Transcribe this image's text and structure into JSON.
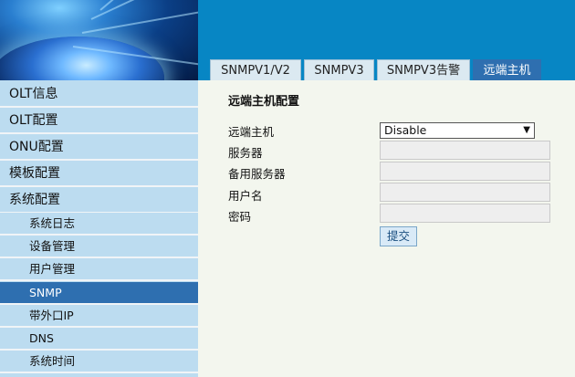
{
  "tabs": [
    {
      "label": "SNMPV1/V2"
    },
    {
      "label": "SNMPV3"
    },
    {
      "label": "SNMPV3告警"
    },
    {
      "label": "远端主机",
      "active": true
    }
  ],
  "sidebar": {
    "items": [
      {
        "label": "OLT信息",
        "level": "top"
      },
      {
        "label": "OLT配置",
        "level": "top"
      },
      {
        "label": "ONU配置",
        "level": "top"
      },
      {
        "label": "模板配置",
        "level": "top"
      },
      {
        "label": "系统配置",
        "level": "top"
      },
      {
        "label": "系统日志",
        "level": "sub"
      },
      {
        "label": "设备管理",
        "level": "sub"
      },
      {
        "label": "用户管理",
        "level": "sub"
      },
      {
        "label": "SNMP",
        "level": "sub",
        "selected": true
      },
      {
        "label": "带外口IP",
        "level": "sub"
      },
      {
        "label": "DNS",
        "level": "sub"
      },
      {
        "label": "系统时间",
        "level": "sub"
      }
    ]
  },
  "form": {
    "title": "远端主机配置",
    "remote_host_label": "远端主机",
    "remote_host_value": "Disable",
    "server_label": "服务器",
    "server_value": "",
    "backup_server_label": "备用服务器",
    "backup_server_value": "",
    "username_label": "用户名",
    "username_value": "",
    "password_label": "密码",
    "password_value": "",
    "submit_label": "提交"
  },
  "colors": {
    "header_blue": "#0786c4",
    "selected_blue": "#2e6fb0",
    "sidebar_bg": "#bcdcf0"
  }
}
